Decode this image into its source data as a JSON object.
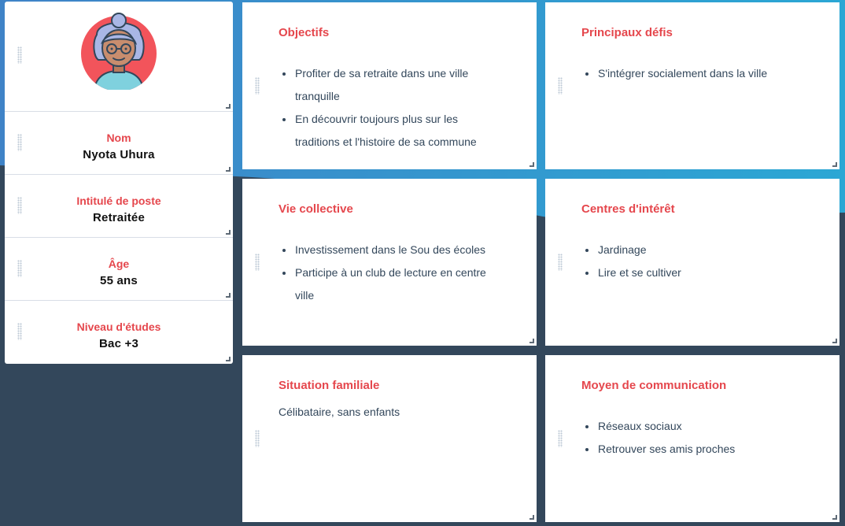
{
  "colors": {
    "accent": "#e5474d",
    "text": "#33475b",
    "background_dark": "#33475b",
    "background_top": "#2ba3d2"
  },
  "persona": {
    "avatar_icon": "elderly-woman-avatar-icon",
    "fields": [
      {
        "label": "Nom",
        "value": "Nyota Uhura"
      },
      {
        "label": "Intitulé de poste",
        "value": "Retraitée"
      },
      {
        "label": "Âge",
        "value": "55 ans"
      },
      {
        "label": "Niveau d'études",
        "value": "Bac +3"
      }
    ]
  },
  "cards": {
    "objectifs": {
      "title": "Objectifs",
      "items": [
        "Profiter de sa retraite dans une ville tranquille",
        "En découvrir toujours plus sur les traditions et l'histoire de sa commune"
      ]
    },
    "defis": {
      "title": "Principaux défis",
      "items": [
        "S'intégrer socialement dans la ville"
      ]
    },
    "vie_collective": {
      "title": "Vie collective",
      "items": [
        "Investissement dans le Sou des écoles",
        "Participe à un club de lecture en centre ville"
      ]
    },
    "interets": {
      "title": "Centres d'intérêt",
      "items": [
        "Jardinage",
        "Lire et se cultiver"
      ]
    },
    "situation": {
      "title": "Situation familiale",
      "text": "Célibataire, sans enfants"
    },
    "communication": {
      "title": "Moyen de communication",
      "items": [
        "Réseaux sociaux",
        "Retrouver ses amis proches"
      ]
    }
  }
}
